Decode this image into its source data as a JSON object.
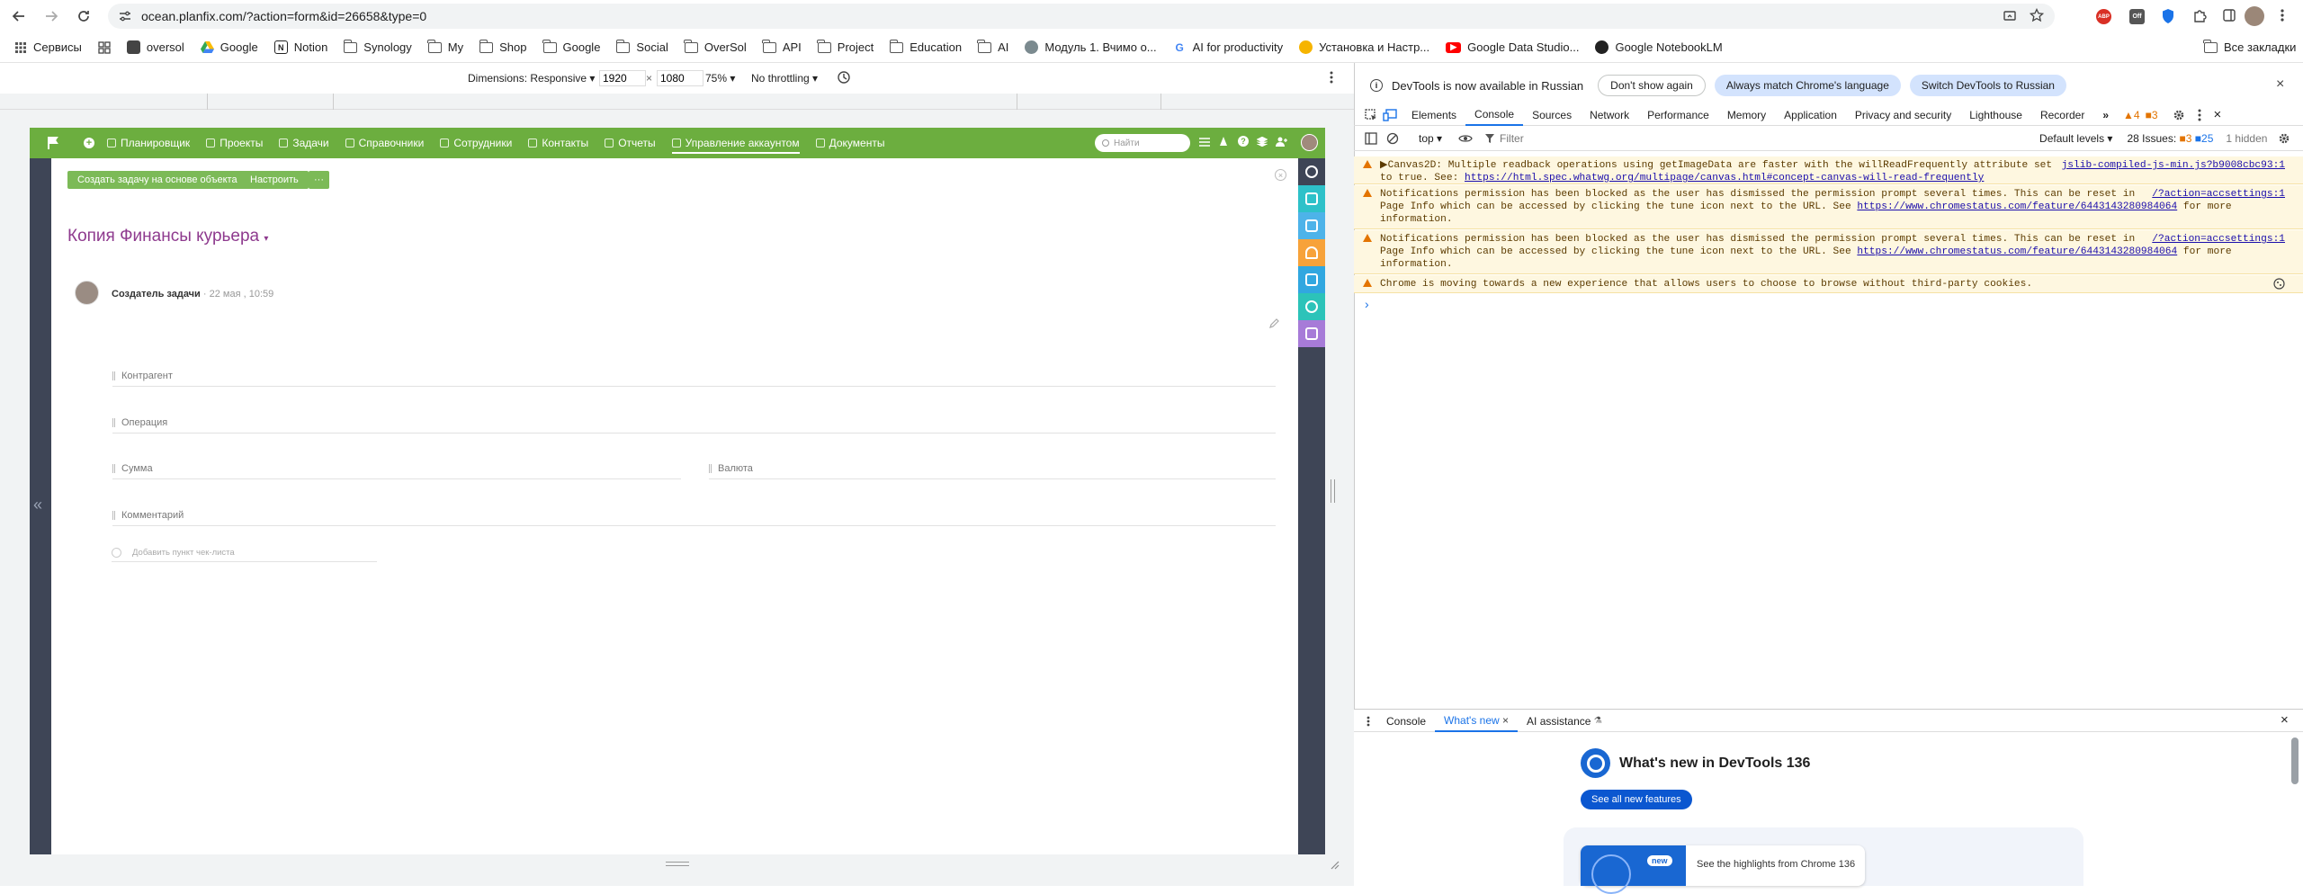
{
  "browser": {
    "url": "ocean.planfix.com/?action=form&id=26658&type=0",
    "bookmarks": [
      "Сервисы",
      "oversol",
      "Google",
      "Notion",
      "Synology",
      "My",
      "Shop",
      "Google",
      "Social",
      "OverSol",
      "API",
      "Project",
      "Education",
      "AI",
      "Модуль 1. Вчимо о...",
      "AI for productivity",
      "Установка и Настр...",
      "Google Data Studio...",
      "Google NotebookLM"
    ],
    "all_bookmarks": "Все закладки"
  },
  "device_toolbar": {
    "dimensions_label": "Dimensions: Responsive",
    "width": "1920",
    "times": "×",
    "height": "1080",
    "zoom": "75%",
    "throttling": "No throttling"
  },
  "app": {
    "nav": [
      "Планировщик",
      "Проекты",
      "Задачи",
      "Справочники",
      "Сотрудники",
      "Контакты",
      "Отчеты",
      "Управление аккаунтом",
      "Документы"
    ],
    "active_nav": "Управление аккаунтом",
    "search_placeholder": "Найти",
    "btn_create_task": "Создать задачу на основе объекта",
    "btn_configure": "Настроить",
    "btn_more": "···",
    "title": "Копия Финансы курьера",
    "author": "Создатель задачи",
    "bullet": "·",
    "date": "22 мая , 10:59",
    "fields": {
      "contragent": "Контрагент",
      "operation": "Операция",
      "sum": "Сумма",
      "currency": "Валюта",
      "comment": "Комментарий",
      "checklist_add": "Добавить пункт чек-листа"
    }
  },
  "devtools": {
    "notice": "DevTools is now available in Russian",
    "btn_dont_show": "Don't show again",
    "btn_match": "Always match Chrome's language",
    "btn_switch": "Switch DevTools to Russian",
    "tabs": [
      "Elements",
      "Console",
      "Sources",
      "Network",
      "Performance",
      "Memory",
      "Application",
      "Privacy and security",
      "Lighthouse",
      "Recorder"
    ],
    "active_tab": "Console",
    "warn_count": "4",
    "error_count": "3",
    "context": "top",
    "filter_placeholder": "Filter",
    "levels": "Default levels",
    "issues_label": "28 Issues:",
    "issues_a": "3",
    "issues_b": "25",
    "hidden": "1 hidden",
    "messages": [
      {
        "l1": "▶Canvas2D: Multiple readback operations using getImageData are faster with the willReadFrequently attribute set",
        "l2pre": "to true. See: ",
        "link": "https://html.spec.whatwg.org/multipage/canvas.html#concept-canvas-will-read-frequently",
        "src": "jslib-compiled-js-min.js?b9008cbc93:1"
      },
      {
        "l1": "Notifications permission has been blocked as the user has dismissed the permission prompt several times. This can be reset in",
        "l2pre": "Page Info which can be accessed by clicking the tune icon next to the URL. See ",
        "link": "https://www.chromestatus.com/feature/6443143280984064",
        "l2post": " for more",
        "l3": "information.",
        "src": "/?action=accsettings:1"
      },
      {
        "l1": "Notifications permission has been blocked as the user has dismissed the permission prompt several times. This can be reset in",
        "l2pre": "Page Info which can be accessed by clicking the tune icon next to the URL. See ",
        "link": "https://www.chromestatus.com/feature/6443143280984064",
        "l2post": " for more",
        "l3": "information.",
        "src": "/?action=accsettings:1"
      },
      {
        "l1": "Chrome is moving towards a new experience that allows users to choose to browse without third-party cookies."
      }
    ],
    "prompt": "›",
    "drawer_tabs": [
      "Console",
      "What's new",
      "AI assistance"
    ],
    "active_drawer_tab": "What's new",
    "whats_new_title": "What's new in DevTools 136",
    "see_all": "See all new features",
    "new_badge": "new",
    "highlights": "See the highlights from Chrome 136"
  }
}
